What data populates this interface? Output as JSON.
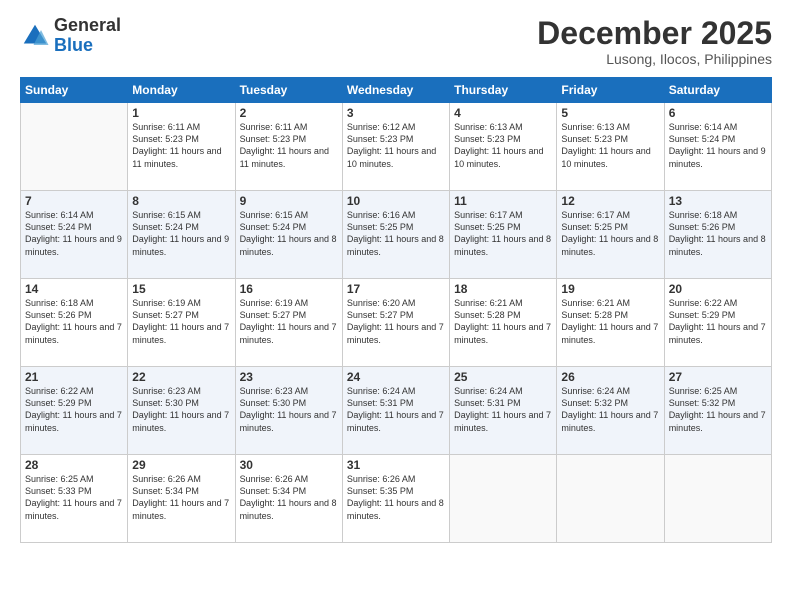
{
  "logo": {
    "general": "General",
    "blue": "Blue"
  },
  "header": {
    "month": "December 2025",
    "location": "Lusong, Ilocos, Philippines"
  },
  "weekdays": [
    "Sunday",
    "Monday",
    "Tuesday",
    "Wednesday",
    "Thursday",
    "Friday",
    "Saturday"
  ],
  "weeks": [
    [
      {
        "day": "",
        "sunrise": "",
        "sunset": "",
        "daylight": ""
      },
      {
        "day": "1",
        "sunrise": "Sunrise: 6:11 AM",
        "sunset": "Sunset: 5:23 PM",
        "daylight": "Daylight: 11 hours and 11 minutes."
      },
      {
        "day": "2",
        "sunrise": "Sunrise: 6:11 AM",
        "sunset": "Sunset: 5:23 PM",
        "daylight": "Daylight: 11 hours and 11 minutes."
      },
      {
        "day": "3",
        "sunrise": "Sunrise: 6:12 AM",
        "sunset": "Sunset: 5:23 PM",
        "daylight": "Daylight: 11 hours and 10 minutes."
      },
      {
        "day": "4",
        "sunrise": "Sunrise: 6:13 AM",
        "sunset": "Sunset: 5:23 PM",
        "daylight": "Daylight: 11 hours and 10 minutes."
      },
      {
        "day": "5",
        "sunrise": "Sunrise: 6:13 AM",
        "sunset": "Sunset: 5:23 PM",
        "daylight": "Daylight: 11 hours and 10 minutes."
      },
      {
        "day": "6",
        "sunrise": "Sunrise: 6:14 AM",
        "sunset": "Sunset: 5:24 PM",
        "daylight": "Daylight: 11 hours and 9 minutes."
      }
    ],
    [
      {
        "day": "7",
        "sunrise": "Sunrise: 6:14 AM",
        "sunset": "Sunset: 5:24 PM",
        "daylight": "Daylight: 11 hours and 9 minutes."
      },
      {
        "day": "8",
        "sunrise": "Sunrise: 6:15 AM",
        "sunset": "Sunset: 5:24 PM",
        "daylight": "Daylight: 11 hours and 9 minutes."
      },
      {
        "day": "9",
        "sunrise": "Sunrise: 6:15 AM",
        "sunset": "Sunset: 5:24 PM",
        "daylight": "Daylight: 11 hours and 8 minutes."
      },
      {
        "day": "10",
        "sunrise": "Sunrise: 6:16 AM",
        "sunset": "Sunset: 5:25 PM",
        "daylight": "Daylight: 11 hours and 8 minutes."
      },
      {
        "day": "11",
        "sunrise": "Sunrise: 6:17 AM",
        "sunset": "Sunset: 5:25 PM",
        "daylight": "Daylight: 11 hours and 8 minutes."
      },
      {
        "day": "12",
        "sunrise": "Sunrise: 6:17 AM",
        "sunset": "Sunset: 5:25 PM",
        "daylight": "Daylight: 11 hours and 8 minutes."
      },
      {
        "day": "13",
        "sunrise": "Sunrise: 6:18 AM",
        "sunset": "Sunset: 5:26 PM",
        "daylight": "Daylight: 11 hours and 8 minutes."
      }
    ],
    [
      {
        "day": "14",
        "sunrise": "Sunrise: 6:18 AM",
        "sunset": "Sunset: 5:26 PM",
        "daylight": "Daylight: 11 hours and 7 minutes."
      },
      {
        "day": "15",
        "sunrise": "Sunrise: 6:19 AM",
        "sunset": "Sunset: 5:27 PM",
        "daylight": "Daylight: 11 hours and 7 minutes."
      },
      {
        "day": "16",
        "sunrise": "Sunrise: 6:19 AM",
        "sunset": "Sunset: 5:27 PM",
        "daylight": "Daylight: 11 hours and 7 minutes."
      },
      {
        "day": "17",
        "sunrise": "Sunrise: 6:20 AM",
        "sunset": "Sunset: 5:27 PM",
        "daylight": "Daylight: 11 hours and 7 minutes."
      },
      {
        "day": "18",
        "sunrise": "Sunrise: 6:21 AM",
        "sunset": "Sunset: 5:28 PM",
        "daylight": "Daylight: 11 hours and 7 minutes."
      },
      {
        "day": "19",
        "sunrise": "Sunrise: 6:21 AM",
        "sunset": "Sunset: 5:28 PM",
        "daylight": "Daylight: 11 hours and 7 minutes."
      },
      {
        "day": "20",
        "sunrise": "Sunrise: 6:22 AM",
        "sunset": "Sunset: 5:29 PM",
        "daylight": "Daylight: 11 hours and 7 minutes."
      }
    ],
    [
      {
        "day": "21",
        "sunrise": "Sunrise: 6:22 AM",
        "sunset": "Sunset: 5:29 PM",
        "daylight": "Daylight: 11 hours and 7 minutes."
      },
      {
        "day": "22",
        "sunrise": "Sunrise: 6:23 AM",
        "sunset": "Sunset: 5:30 PM",
        "daylight": "Daylight: 11 hours and 7 minutes."
      },
      {
        "day": "23",
        "sunrise": "Sunrise: 6:23 AM",
        "sunset": "Sunset: 5:30 PM",
        "daylight": "Daylight: 11 hours and 7 minutes."
      },
      {
        "day": "24",
        "sunrise": "Sunrise: 6:24 AM",
        "sunset": "Sunset: 5:31 PM",
        "daylight": "Daylight: 11 hours and 7 minutes."
      },
      {
        "day": "25",
        "sunrise": "Sunrise: 6:24 AM",
        "sunset": "Sunset: 5:31 PM",
        "daylight": "Daylight: 11 hours and 7 minutes."
      },
      {
        "day": "26",
        "sunrise": "Sunrise: 6:24 AM",
        "sunset": "Sunset: 5:32 PM",
        "daylight": "Daylight: 11 hours and 7 minutes."
      },
      {
        "day": "27",
        "sunrise": "Sunrise: 6:25 AM",
        "sunset": "Sunset: 5:32 PM",
        "daylight": "Daylight: 11 hours and 7 minutes."
      }
    ],
    [
      {
        "day": "28",
        "sunrise": "Sunrise: 6:25 AM",
        "sunset": "Sunset: 5:33 PM",
        "daylight": "Daylight: 11 hours and 7 minutes."
      },
      {
        "day": "29",
        "sunrise": "Sunrise: 6:26 AM",
        "sunset": "Sunset: 5:34 PM",
        "daylight": "Daylight: 11 hours and 7 minutes."
      },
      {
        "day": "30",
        "sunrise": "Sunrise: 6:26 AM",
        "sunset": "Sunset: 5:34 PM",
        "daylight": "Daylight: 11 hours and 8 minutes."
      },
      {
        "day": "31",
        "sunrise": "Sunrise: 6:26 AM",
        "sunset": "Sunset: 5:35 PM",
        "daylight": "Daylight: 11 hours and 8 minutes."
      },
      {
        "day": "",
        "sunrise": "",
        "sunset": "",
        "daylight": ""
      },
      {
        "day": "",
        "sunrise": "",
        "sunset": "",
        "daylight": ""
      },
      {
        "day": "",
        "sunrise": "",
        "sunset": "",
        "daylight": ""
      }
    ]
  ]
}
